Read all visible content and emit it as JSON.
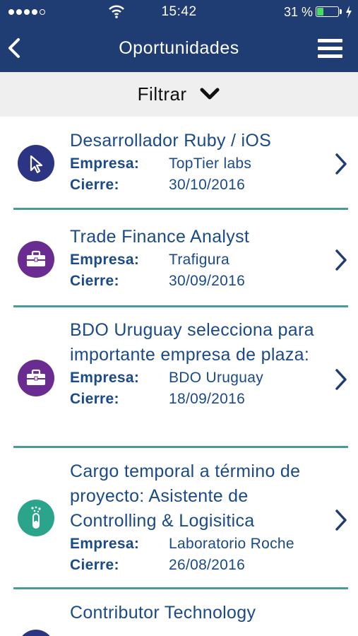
{
  "status": {
    "time": "15:42",
    "battery": "31 %",
    "battery_level": 0.31
  },
  "nav": {
    "title": "Oportunidades"
  },
  "filter": {
    "label": "Filtrar"
  },
  "labels": {
    "empresa": "Empresa:",
    "cierre": "Cierre:"
  },
  "items": [
    {
      "title": "Desarrollador Ruby / iOS",
      "empresa": "TopTier labs",
      "cierre": "30/10/2016",
      "icon": "cursor-icon",
      "color": "#2c3584"
    },
    {
      "title": "Trade Finance Analyst",
      "empresa": "Trafigura",
      "cierre": "30/09/2016",
      "icon": "briefcase-icon",
      "color": "#6a2c91"
    },
    {
      "title": "BDO Uruguay selecciona para importante empresa de plaza:",
      "empresa": "BDO Uruguay",
      "cierre": "18/09/2016",
      "icon": "briefcase-icon",
      "color": "#6a2c91"
    },
    {
      "title": "Cargo temporal a término de proyecto: Asistente de Controlling & Logisitica",
      "empresa": "Laboratorio Roche",
      "cierre": "26/08/2016",
      "icon": "test-tube-icon",
      "color": "#2aa58c"
    },
    {
      "title": "Contributor Technology",
      "icon": "cursor-icon",
      "color": "#2c3584"
    }
  ]
}
